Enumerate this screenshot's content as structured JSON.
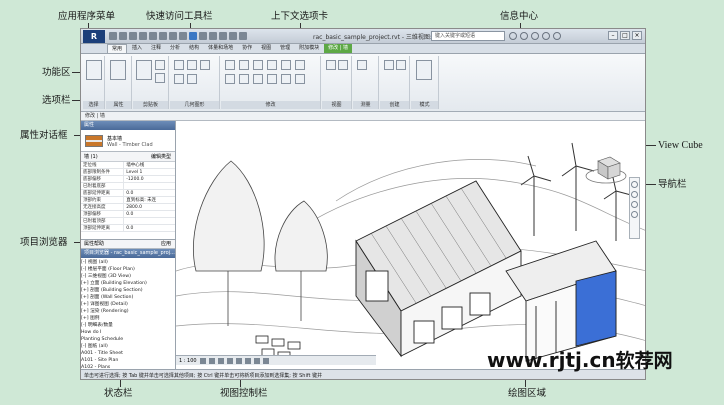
{
  "annotations": {
    "app_menu": "应用程序菜单",
    "quick_access": "快速访问工具栏",
    "context_tab": "上下文选项卡",
    "info_center": "信息中心",
    "ribbon": "功能区",
    "options_bar": "选项栏",
    "properties": "属性对话框",
    "project_browser": "项目浏览器",
    "view_cube": "View Cube",
    "nav_bar": "导航栏",
    "status_bar": "状态栏",
    "view_control_bar": "视图控制栏",
    "drawing_area": "绘图区域"
  },
  "window": {
    "title": "rac_basic_sample_project.rvt - 三维视图: From Yard",
    "app_button": "R",
    "search_placeholder": "键入关键字或短语"
  },
  "tabs": [
    "常用",
    "插入",
    "注释",
    "分析",
    "结构",
    "体量和场地",
    "协作",
    "视图",
    "管理",
    "附加模块",
    "修改 | 墙"
  ],
  "ribbon_panels": [
    "选择",
    "属性",
    "剪贴板",
    "几何图形",
    "修改",
    "视图",
    "测量",
    "创建",
    "模式"
  ],
  "options_bar": "修改 | 墙",
  "properties_panel": {
    "header": "属性",
    "type_name": "基本墙",
    "type_sub": "Wall - Timber Clad",
    "instance": "墙 (1)",
    "edit_type": "编辑类型",
    "rows": [
      [
        "定位线",
        "墙中心线"
      ],
      [
        "底部限制条件",
        "Level 1"
      ],
      [
        "底部偏移",
        "-1200.0"
      ],
      [
        "已附着底部",
        ""
      ],
      [
        "底部延伸距离",
        "0.0"
      ],
      [
        "顶部约束",
        "直到标高: 未连"
      ],
      [
        "无连接高度",
        "2800.0"
      ],
      [
        "顶部偏移",
        "0.0"
      ],
      [
        "已附着顶部",
        ""
      ],
      [
        "顶部延伸距离",
        "0.0"
      ]
    ],
    "help": "属性帮助",
    "apply": "应用"
  },
  "project_browser": {
    "header": "项目浏览器 - rac_basic_sample_proj...",
    "items": [
      "[-] 视图 (all)",
      "  [-] 楼层平面 (Floor Plan)",
      "  [-] 三维视图 (3D View)",
      "  [+] 立面 (Building Elevation)",
      "  [+] 剖面 (Building Section)",
      "  [+] 剖面 (Wall Section)",
      "  [+] 详图视图 (Detail)",
      "  [+] 渲染 (Rendering)",
      "[+] 图例",
      "[-] 明细表/数量",
      "    How do I",
      "    Planting Schedule",
      "[-] 图纸 (all)",
      "    A001 - Title Sheet",
      "    A101 - Site Plan",
      "    A102 - Plans"
    ]
  },
  "view_control": {
    "scale": "1 : 100"
  },
  "status_bar": "单击可进行选择; 按 Tab 键并单击可选择其他项目; 按 Ctrl 键并单击可将新项目添加到选择集; 按 Shift 键并",
  "watermark": {
    "site": "www.rjtj.cn",
    "cn": "软荐网"
  },
  "colors": {
    "background": "#cfe8d6",
    "context_tab": "#5da845",
    "panel_header": "#4a6a99",
    "glass": "#3b6fd6"
  }
}
